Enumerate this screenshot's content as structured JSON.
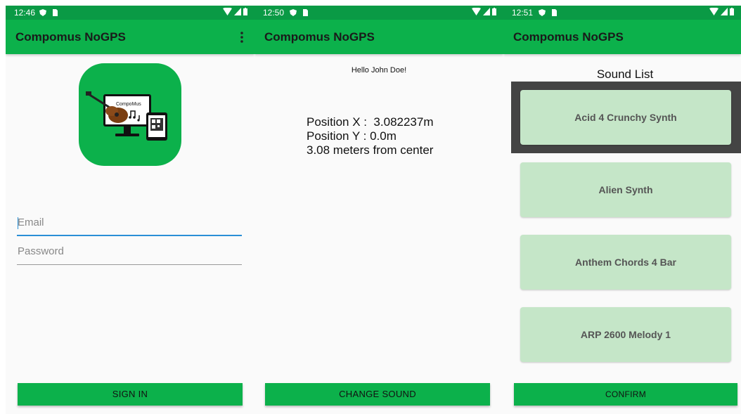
{
  "app_title": "Compomus NoGPS",
  "colors": {
    "accent": "#0cb14b",
    "status": "#0a9a45",
    "sound_item": "#c5e6c8",
    "focus": "#2a8fd6"
  },
  "screen1": {
    "time": "12:46",
    "logo_text": "CompoMus",
    "email_placeholder": "Email",
    "password_placeholder": "Password",
    "sign_in_label": "SIGN IN"
  },
  "screen2": {
    "time": "12:50",
    "greeting": "Hello John Doe!",
    "position_x": "Position X :  3.082237m",
    "position_y": "Position Y : 0.0m",
    "distance": "3.08 meters from center",
    "change_sound_label": "CHANGE SOUND"
  },
  "screen3": {
    "time": "12:51",
    "list_title": "Sound List",
    "sounds": [
      "Acid 4 Crunchy Synth",
      "Alien Synth",
      "Anthem Chords 4 Bar",
      "ARP 2600 Melody 1"
    ],
    "selected_index": 0,
    "confirm_label": "CONFIRM"
  },
  "icons": [
    "shield-icon",
    "sim-icon",
    "wifi-icon",
    "signal-icon",
    "battery-icon",
    "overflow-menu-icon"
  ]
}
